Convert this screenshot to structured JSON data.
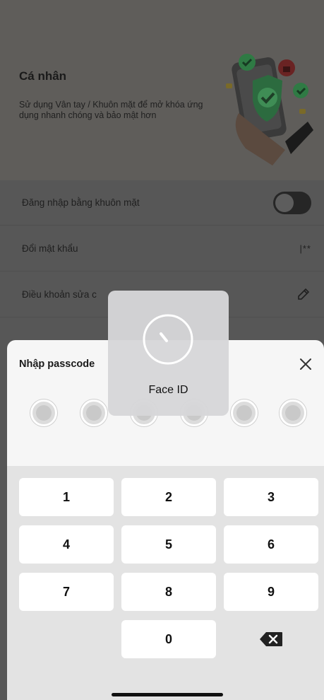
{
  "header": {
    "title": "Cá nhân",
    "description": "Sử dụng Vân tay / Khuôn mặt để mở khóa ứng dụng nhanh chóng và bảo mật hơn"
  },
  "settings": [
    {
      "label": "Đăng nhập bằng khuôn mặt",
      "right": "toggle",
      "toggle_on": false
    },
    {
      "label": "Đổi mật khẩu",
      "right": "text",
      "value": "|**"
    },
    {
      "label": "Điều khoản sửa c",
      "right": "pen-icon"
    }
  ],
  "passcode_sheet": {
    "title": "Nhập passcode",
    "digit_slots": 6,
    "keys": [
      "1",
      "2",
      "3",
      "4",
      "5",
      "6",
      "7",
      "8",
      "9",
      "0"
    ]
  },
  "faceid_hud": {
    "label": "Face ID"
  },
  "colors": {
    "accent_green": "#3db36b",
    "sheet_bg": "#f6f6f6",
    "keypad_bg": "#e3e3e3"
  }
}
